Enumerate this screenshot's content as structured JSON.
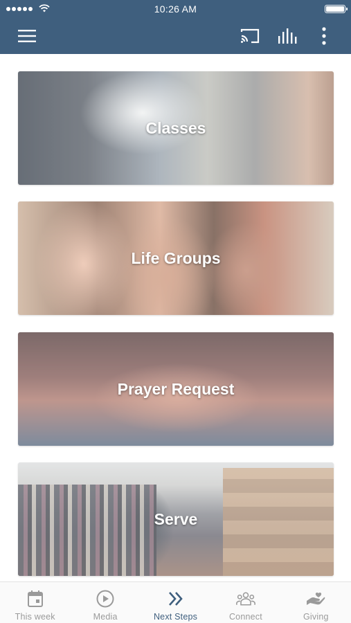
{
  "status_bar": {
    "time": "10:26 AM",
    "signal_icon": "signal-dots-icon",
    "wifi_icon": "wifi-icon",
    "battery_icon": "battery-icon"
  },
  "toolbar": {
    "menu_icon": "hamburger-menu-icon",
    "cast_icon": "cast-icon",
    "audio_icon": "equalizer-icon",
    "more_icon": "more-vertical-icon",
    "background_color": "#3f5f7e"
  },
  "cards": [
    {
      "label": "Classes"
    },
    {
      "label": "Life Groups"
    },
    {
      "label": "Prayer Request"
    },
    {
      "label": "Serve"
    }
  ],
  "tabbar": {
    "active_color": "#3f5f7e",
    "inactive_color": "#9a9a9a",
    "tabs": [
      {
        "label": "This week",
        "icon": "calendar-icon",
        "active": false
      },
      {
        "label": "Media",
        "icon": "play-circle-icon",
        "active": false
      },
      {
        "label": "Next Steps",
        "icon": "double-chevron-right-icon",
        "active": true
      },
      {
        "label": "Connect",
        "icon": "group-icon",
        "active": false
      },
      {
        "label": "Giving",
        "icon": "giving-hand-icon",
        "active": false
      }
    ]
  }
}
